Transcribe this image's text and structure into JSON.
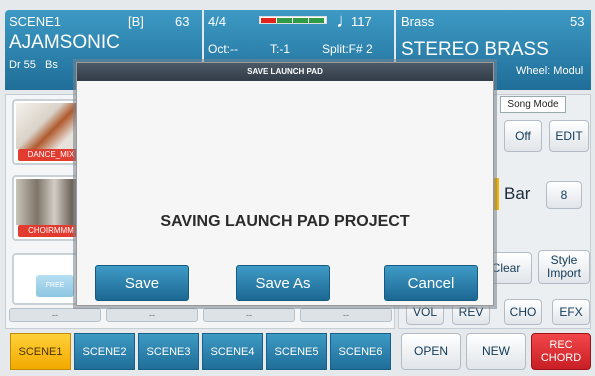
{
  "left_header": {
    "scene": "SCENE1",
    "bank": "[B]",
    "number": "63",
    "name": "AJAMSONIC",
    "drum": "Dr 55",
    "bass": "Bs"
  },
  "mid_header": {
    "time_sig": "4/4",
    "tempo": "117",
    "tempo_colors": [
      "#e0241b",
      "#2f9b45",
      "#2f9b45",
      "#2f9b45"
    ],
    "octave": "Oct:--",
    "transpose": "T:-1",
    "split": "Split:F# 2"
  },
  "right_header": {
    "category": "Brass",
    "number": "53",
    "name": "STEREO BRASS",
    "wheel": "Wheel: Modul"
  },
  "pads": [
    {
      "label": "DANCE_MIX"
    },
    {
      "label": "CHOIRMMM"
    },
    {
      "label": "FREE"
    }
  ],
  "empty_slots": [
    "--",
    "--",
    "--",
    "--"
  ],
  "right_panel": {
    "tooltip": "Song Mode",
    "off": "Off",
    "edit": "EDIT",
    "bar": "Bar",
    "bar_value": "8",
    "clear": "Clear",
    "style_import": "Style Import",
    "vol": "VOL",
    "rev": "REV",
    "cho": "CHO",
    "efx": "EFX"
  },
  "scenes": [
    "SCENE1",
    "SCENE2",
    "SCENE3",
    "SCENE4",
    "SCENE5",
    "SCENE6"
  ],
  "bottom": {
    "open": "OPEN",
    "new": "NEW",
    "rec": "REC CHORD"
  },
  "dialog": {
    "title": "SAVE LAUNCH PAD",
    "message": "SAVING LAUNCH PAD PROJECT",
    "save": "Save",
    "save_as": "Save As",
    "cancel": "Cancel"
  }
}
